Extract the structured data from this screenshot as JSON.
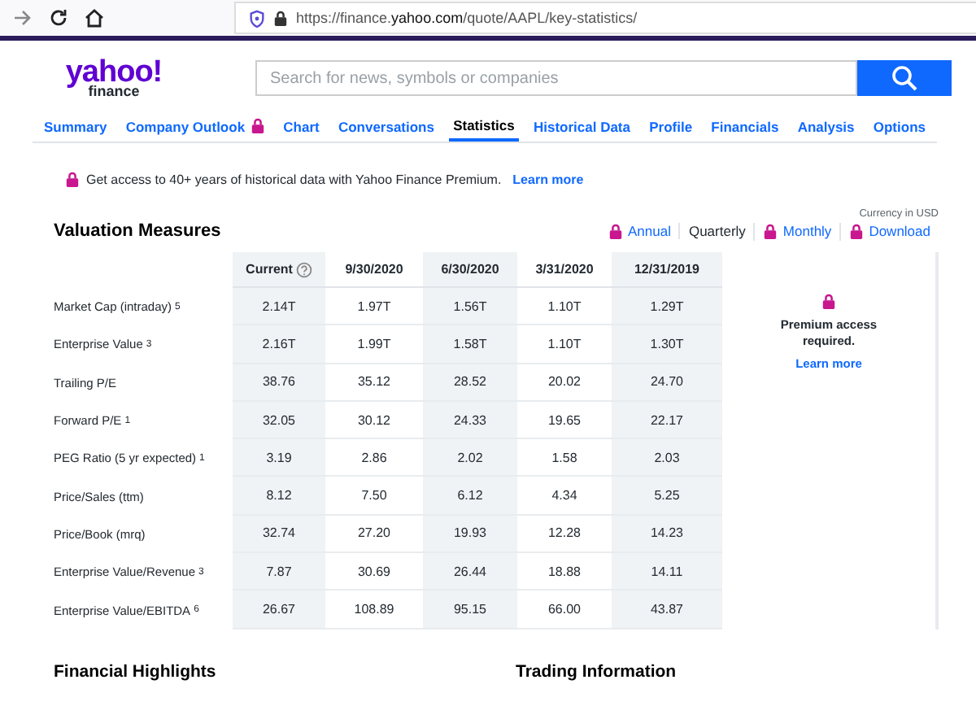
{
  "browser": {
    "url_host_prefix": "https://finance.",
    "url_host_bold": "yahoo.com",
    "url_path": "/quote/AAPL/key-statistics/"
  },
  "header": {
    "logo_main": "yahoo!",
    "logo_sub": "finance",
    "search_placeholder": "Search for news, symbols or companies"
  },
  "tabs": [
    {
      "label": "Summary",
      "selected": false,
      "locked": false
    },
    {
      "label": "Company Outlook",
      "selected": false,
      "locked": true
    },
    {
      "label": "Chart",
      "selected": false,
      "locked": false
    },
    {
      "label": "Conversations",
      "selected": false,
      "locked": false
    },
    {
      "label": "Statistics",
      "selected": true,
      "locked": false
    },
    {
      "label": "Historical Data",
      "selected": false,
      "locked": false
    },
    {
      "label": "Profile",
      "selected": false,
      "locked": false
    },
    {
      "label": "Financials",
      "selected": false,
      "locked": false
    },
    {
      "label": "Analysis",
      "selected": false,
      "locked": false
    },
    {
      "label": "Options",
      "selected": false,
      "locked": false
    }
  ],
  "banner": {
    "text": "Get access to 40+ years of historical data with Yahoo Finance Premium.",
    "link": "Learn more"
  },
  "valuation": {
    "title": "Valuation Measures",
    "currency": "Currency in USD",
    "periods": [
      {
        "label": "Annual",
        "selected": false,
        "locked": true
      },
      {
        "label": "Quarterly",
        "selected": true,
        "locked": false
      },
      {
        "label": "Monthly",
        "selected": false,
        "locked": true
      },
      {
        "label": "Download",
        "selected": false,
        "locked": true
      }
    ],
    "columns": [
      "Current",
      "9/30/2020",
      "6/30/2020",
      "3/31/2020",
      "12/31/2019"
    ],
    "rows": [
      {
        "label": "Market Cap (intraday) $^{5}$",
        "values": [
          "2.14T",
          "1.97T",
          "1.56T",
          "1.10T",
          "1.29T"
        ]
      },
      {
        "label": "Enterprise Value $^{3}$",
        "values": [
          "2.16T",
          "1.99T",
          "1.58T",
          "1.10T",
          "1.30T"
        ]
      },
      {
        "label": "Trailing P/E",
        "values": [
          "38.76",
          "35.12",
          "28.52",
          "20.02",
          "24.70"
        ]
      },
      {
        "label": "Forward P/E $^{1}$",
        "values": [
          "32.05",
          "30.12",
          "24.33",
          "19.65",
          "22.17"
        ]
      },
      {
        "label": "PEG Ratio (5 yr expected) $^{1}$",
        "values": [
          "3.19",
          "2.86",
          "2.02",
          "1.58",
          "2.03"
        ]
      },
      {
        "label": "Price/Sales (ttm)",
        "values": [
          "8.12",
          "7.50",
          "6.12",
          "4.34",
          "5.25"
        ]
      },
      {
        "label": "Price/Book (mrq)",
        "values": [
          "32.74",
          "27.20",
          "19.93",
          "12.28",
          "14.23"
        ]
      },
      {
        "label": "Enterprise Value/Revenue $^{3}$",
        "values": [
          "7.87",
          "30.69",
          "26.44",
          "18.88",
          "14.11"
        ]
      },
      {
        "label": "Enterprise Value/EBITDA $^{6}$",
        "values": [
          "26.67",
          "108.89",
          "95.15",
          "66.00",
          "43.87"
        ]
      }
    ],
    "premium": {
      "text": "Premium access required.",
      "link": "Learn more"
    }
  },
  "sections": [
    "Financial Highlights",
    "Trading Information"
  ]
}
